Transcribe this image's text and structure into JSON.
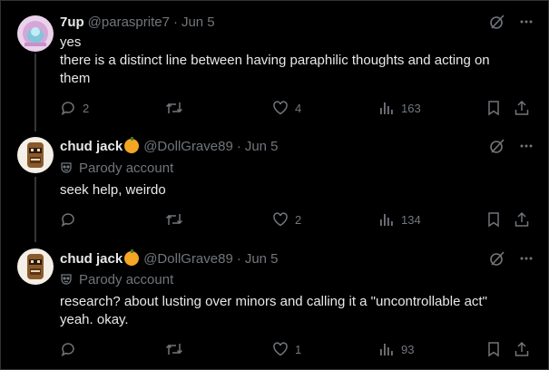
{
  "tweets": [
    {
      "name": "7up",
      "handle": "@parasprite7",
      "separator": "·",
      "date": "Jun 5",
      "lines": [
        "yes",
        "there is a distinct line between having paraphilic thoughts and acting on",
        "them"
      ],
      "replies": "2",
      "retweets": "",
      "likes": "4",
      "views": "163"
    },
    {
      "name": "chud jack",
      "handle": "@DollGrave89",
      "separator": "·",
      "date": "Jun 5",
      "parody": "Parody account",
      "lines": [
        "seek help, weirdo"
      ],
      "replies": "",
      "retweets": "",
      "likes": "2",
      "views": "134"
    },
    {
      "name": "chud jack",
      "handle": "@DollGrave89",
      "separator": "·",
      "date": "Jun 5",
      "parody": "Parody account",
      "lines": [
        "research? about lusting over minors and calling it a \"uncontrollable act\"",
        "yeah. okay."
      ],
      "replies": "",
      "retweets": "",
      "likes": "1",
      "views": "93"
    }
  ],
  "colors": {
    "background": "#000000",
    "text": "#e7e9ea",
    "muted": "#71767b",
    "thread_line": "#333639",
    "badge": "#f5a524"
  },
  "icons": [
    "grok-icon",
    "more-icon",
    "reply-icon",
    "retweet-icon",
    "like-icon",
    "views-icon",
    "bookmark-icon",
    "share-icon",
    "parody-mask-icon",
    "orange-emoji-icon"
  ]
}
